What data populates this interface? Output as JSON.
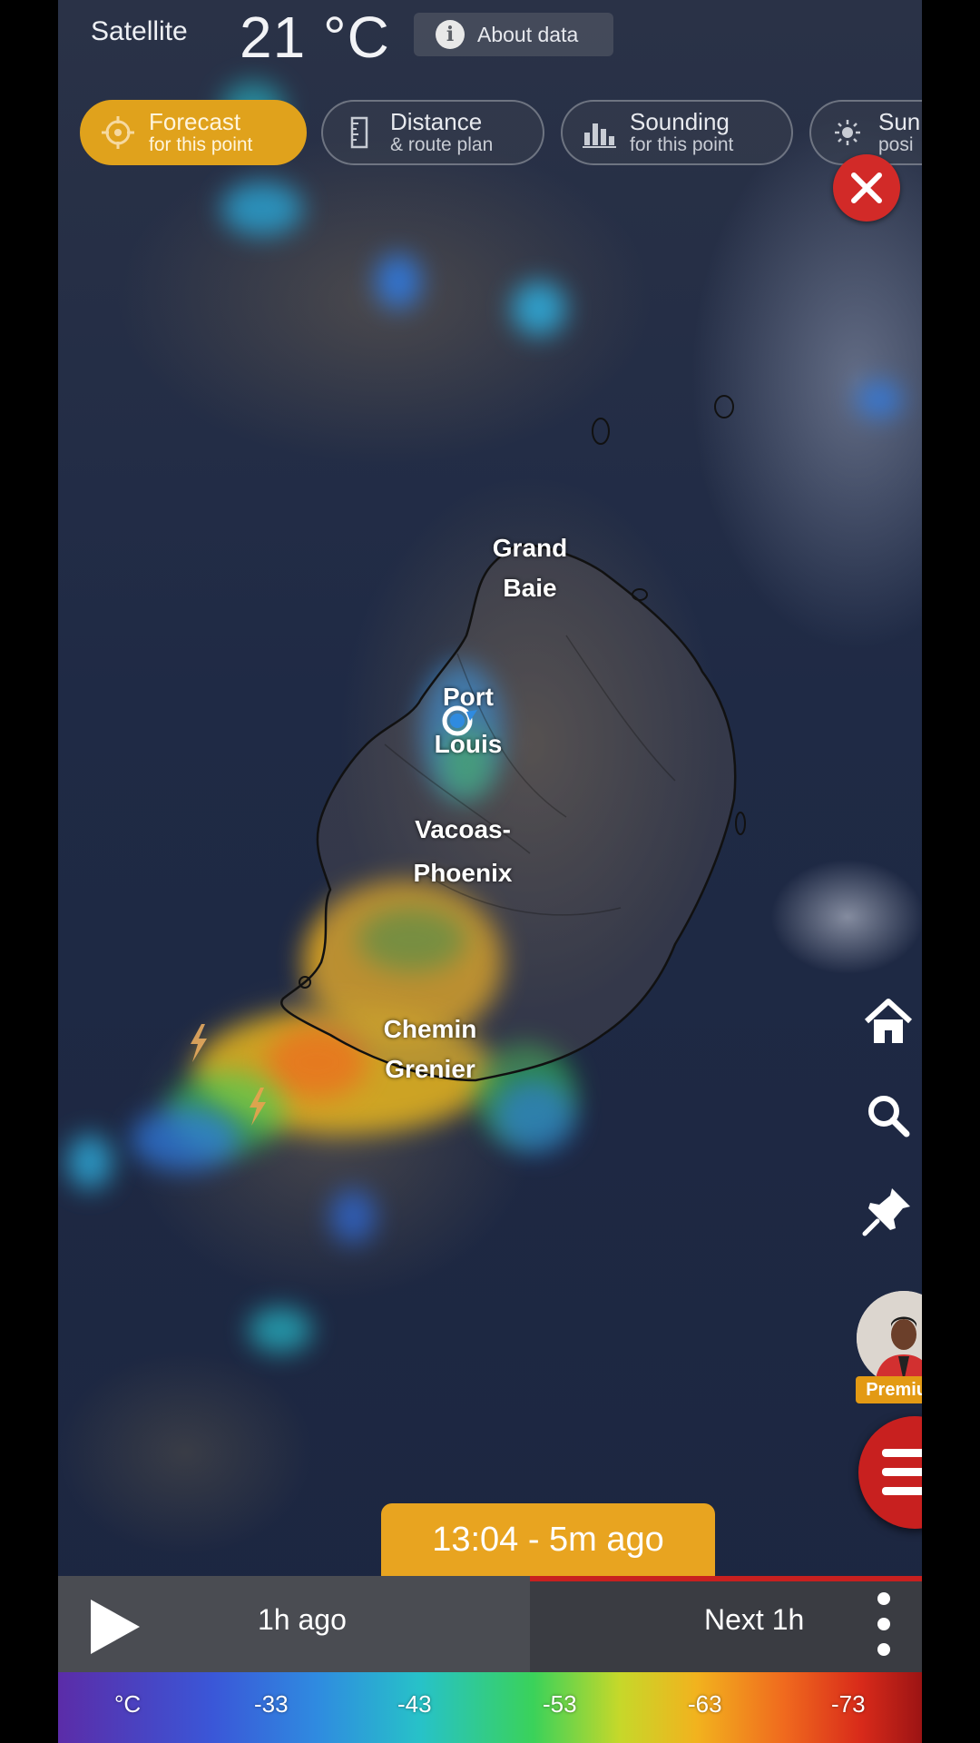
{
  "header": {
    "title": "Satellite",
    "temperature": "21 °C",
    "about_label": "About data"
  },
  "chips": [
    {
      "line1": "Forecast",
      "line2": "for this point",
      "icon": "crosshair-icon",
      "active": true
    },
    {
      "line1": "Distance",
      "line2": "& route plan",
      "icon": "ruler-icon",
      "active": false
    },
    {
      "line1": "Sounding",
      "line2": "for this point",
      "icon": "bar-chart-icon",
      "active": false
    },
    {
      "line1": "Sun",
      "line2": "posi",
      "icon": "sun-icon",
      "active": false
    }
  ],
  "map": {
    "cities": {
      "grand_baie": [
        "Grand",
        "Baie"
      ],
      "port_louis": [
        "Port",
        "Louis"
      ],
      "vacoas": [
        "Vacoas-",
        "Phoenix"
      ],
      "chemin": [
        "Chemin",
        "Grenier"
      ]
    }
  },
  "tools": {
    "premium_label": "Premium"
  },
  "timeline": {
    "current": "13:04 - 5m ago",
    "past": "1h ago",
    "next": "Next 1h"
  },
  "legend": {
    "unit": "°C",
    "values": [
      "-33",
      "-43",
      "-53",
      "-63",
      "-73"
    ]
  },
  "colors": {
    "accent": "#e0a21c",
    "close": "#d22a28",
    "menu": "#c8201f"
  }
}
